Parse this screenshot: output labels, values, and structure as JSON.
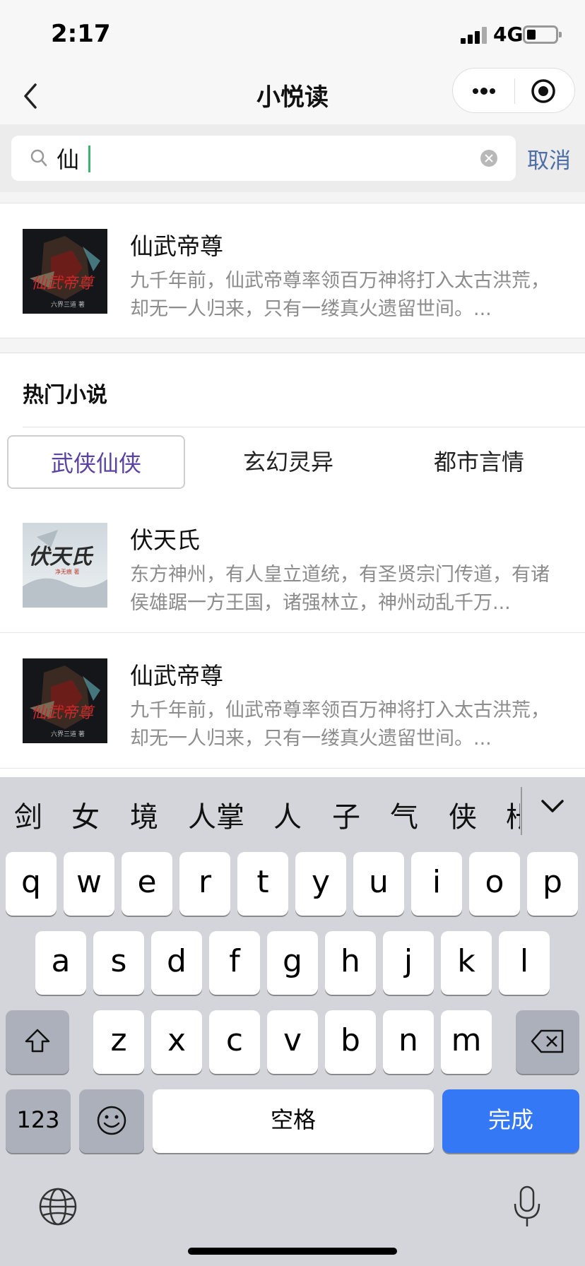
{
  "status": {
    "time": "2:17",
    "network": "4G"
  },
  "nav": {
    "title": "小悦读"
  },
  "search": {
    "value": "仙",
    "cancel": "取消"
  },
  "search_results": [
    {
      "title": "仙武帝尊",
      "desc": "九千年前，仙武帝尊率领百万神将打入太古洪荒，却无一人归来，只有一缕真火遗留世间。..."
    }
  ],
  "hot": {
    "title": "热门小说"
  },
  "tabs": [
    {
      "label": "武侠仙侠",
      "active": true
    },
    {
      "label": "玄幻灵异",
      "active": false
    },
    {
      "label": "都市言情",
      "active": false
    }
  ],
  "hot_books": [
    {
      "title": "伏天氏",
      "desc": "东方神州，有人皇立道统，有圣贤宗门传道，有诸侯雄踞一方王国，诸强林立，神州动乱千万..."
    },
    {
      "title": "仙武帝尊",
      "desc": "九千年前，仙武帝尊率领百万神将打入太古洪荒，却无一人归来，只有一缕真火遗留世间。..."
    }
  ],
  "keyboard": {
    "candidates": [
      "剑",
      "女",
      "境",
      "人掌",
      "人",
      "子",
      "气",
      "侠",
      "枨"
    ],
    "row1": [
      "q",
      "w",
      "e",
      "r",
      "t",
      "y",
      "u",
      "i",
      "o",
      "p"
    ],
    "row2": [
      "a",
      "s",
      "d",
      "f",
      "g",
      "h",
      "j",
      "k",
      "l"
    ],
    "row3": [
      "z",
      "x",
      "c",
      "v",
      "b",
      "n",
      "m"
    ],
    "num_label": "123",
    "space_label": "空格",
    "done_label": "完成"
  },
  "colors": {
    "accent_tab": "#5a43a3",
    "done_key": "#3478f6",
    "cancel_link": "#4e6ea6"
  }
}
